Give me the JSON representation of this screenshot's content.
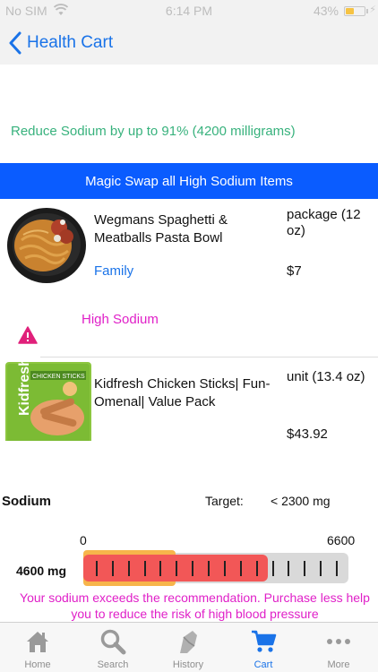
{
  "status_bar": {
    "carrier": "No SIM",
    "time": "6:14 PM",
    "battery_percent": "43%",
    "battery_level": 0.43
  },
  "nav": {
    "back_label": "Health Cart"
  },
  "savings": {
    "text": "Reduce Sodium by up to 91% (4200 milligrams)"
  },
  "magic_swap": {
    "label": "Magic Swap all High Sodium Items"
  },
  "items": [
    {
      "name": "Wegmans Spaghetti & Meatballs Pasta Bowl",
      "size": "package (12 oz)",
      "category": "Family",
      "price": "$7",
      "warning": "High Sodium"
    },
    {
      "name": "Kidfresh Chicken Sticks| Fun-Omenal| Value Pack",
      "size": "unit (13.4 oz)",
      "price": "$43.92",
      "thumb_text": "Kidfresh",
      "thumb_subtext": "CHICKEN STICKS"
    }
  ],
  "sodium": {
    "label": "Sodium",
    "target_label": "Target:",
    "target_value": "<  2300 mg",
    "target_mg": 2300,
    "scale_min": "0",
    "scale_max": "6600",
    "scale_min_value": 0,
    "scale_max_value": 6600,
    "current": "4600 mg",
    "current_mg": 4600,
    "tick_count": 16,
    "warning": "Your sodium exceeds the recommendation. Purchase less help you to reduce the risk of high blood pressure"
  },
  "tabs": [
    {
      "label": "Home",
      "icon": "home-icon",
      "active": false
    },
    {
      "label": "Search",
      "icon": "search-icon",
      "active": false
    },
    {
      "label": "History",
      "icon": "history-icon",
      "active": false
    },
    {
      "label": "Cart",
      "icon": "cart-icon",
      "active": true
    },
    {
      "label": "More",
      "icon": "more-icon",
      "active": false
    }
  ],
  "colors": {
    "accent": "#1a73e8",
    "magic_button": "#0a5cff",
    "savings_green": "#38b27d",
    "warning_magenta": "#e020c8",
    "gauge_fill": "#f25757",
    "gauge_target": "#f7b54b"
  }
}
